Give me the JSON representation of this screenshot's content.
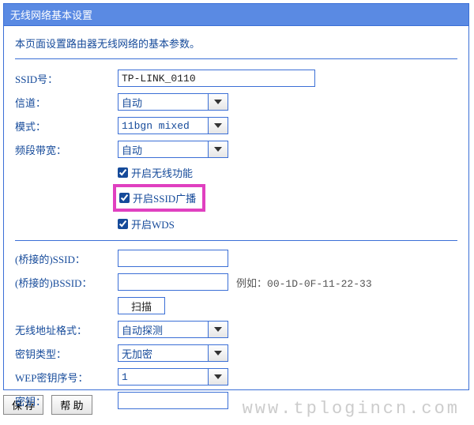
{
  "panel": {
    "title": "无线网络基本设置",
    "intro": "本页面设置路由器无线网络的基本参数。"
  },
  "form": {
    "ssid_label": "SSID号：",
    "ssid_value": "TP-LINK_0110",
    "channel_label": "信道：",
    "channel_value": "自动",
    "mode_label": "模式：",
    "mode_value": "11bgn mixed",
    "bandwidth_label": "频段带宽：",
    "bandwidth_value": "自动",
    "cb_wireless": "开启无线功能",
    "cb_ssid_broadcast": "开启SSID广播",
    "cb_wds": "开启WDS",
    "bridge_ssid_label": "(桥接的)SSID：",
    "bridge_ssid_value": "",
    "bridge_bssid_label": "(桥接的)BSSID：",
    "bridge_bssid_value": "",
    "bssid_example_label": "例如：",
    "bssid_example_value": "00-1D-0F-11-22-33",
    "scan_button": "扫描",
    "addr_format_label": "无线地址格式：",
    "addr_format_value": "自动探测",
    "key_type_label": "密钥类型：",
    "key_type_value": "无加密",
    "wep_index_label": "WEP密钥序号：",
    "wep_index_value": "1",
    "key_label": "密钥：",
    "key_value": ""
  },
  "buttons": {
    "save": "保 存",
    "help": "帮 助"
  },
  "watermark": "www.tplogincn.com"
}
